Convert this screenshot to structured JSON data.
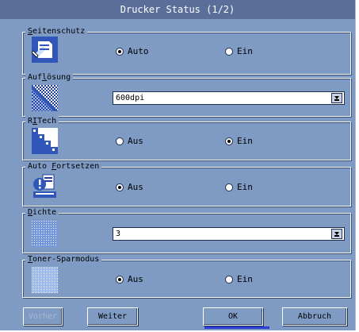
{
  "window": {
    "title": "Drucker Status (1/2)"
  },
  "groups": {
    "seitenschutz": {
      "label": "Seitenschutz",
      "icon": "page-protect-icon",
      "options": [
        "Auto",
        "Ein"
      ],
      "selected": "Auto"
    },
    "aufloesung": {
      "label": "Auflösung",
      "icon": "resolution-icon",
      "value": "600dpi"
    },
    "ritech": {
      "label": "RITech",
      "icon": "ritech-icon",
      "options": [
        "Aus",
        "Ein"
      ],
      "selected": "Ein"
    },
    "auto_fortsetzen": {
      "label": "Auto Fortsetzen",
      "icon": "auto-continue-icon",
      "options": [
        "Aus",
        "Ein"
      ],
      "selected": "Aus"
    },
    "dichte": {
      "label": "Dichte",
      "icon": "density-icon",
      "value": "3"
    },
    "toner_sparmodus": {
      "label": "Toner-Sparmodus",
      "icon": "toner-save-icon",
      "options": [
        "Aus",
        "Ein"
      ],
      "selected": "Aus"
    }
  },
  "buttons": {
    "vorher": "Vorher",
    "weiter": "Weiter",
    "ok": "OK",
    "abbruch": "Abbruch"
  },
  "colors": {
    "window_bg": "#7f9bc4",
    "titlebar": "#5a6e9a",
    "focus": "#2a3fd6"
  }
}
